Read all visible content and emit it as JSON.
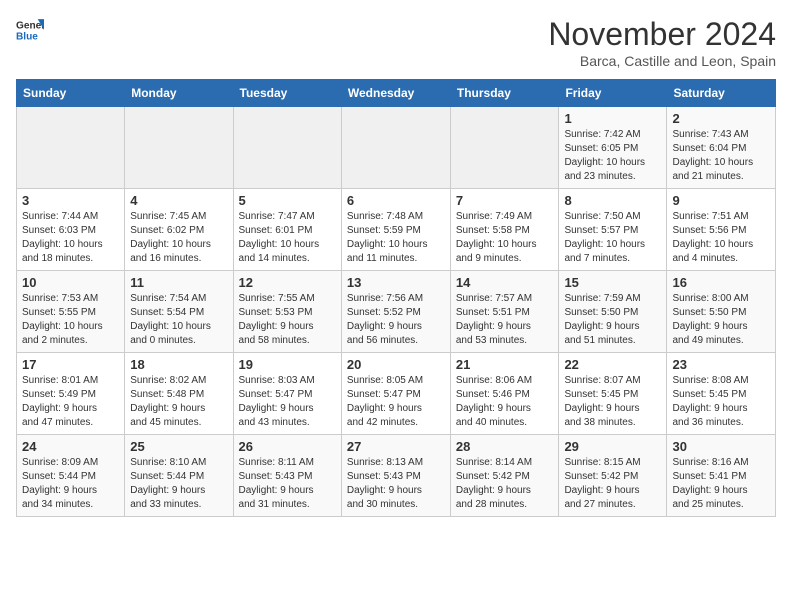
{
  "logo": {
    "line1": "General",
    "line2": "Blue"
  },
  "title": "November 2024",
  "subtitle": "Barca, Castille and Leon, Spain",
  "weekdays": [
    "Sunday",
    "Monday",
    "Tuesday",
    "Wednesday",
    "Thursday",
    "Friday",
    "Saturday"
  ],
  "weeks": [
    [
      {
        "day": "",
        "info": ""
      },
      {
        "day": "",
        "info": ""
      },
      {
        "day": "",
        "info": ""
      },
      {
        "day": "",
        "info": ""
      },
      {
        "day": "",
        "info": ""
      },
      {
        "day": "1",
        "info": "Sunrise: 7:42 AM\nSunset: 6:05 PM\nDaylight: 10 hours\nand 23 minutes."
      },
      {
        "day": "2",
        "info": "Sunrise: 7:43 AM\nSunset: 6:04 PM\nDaylight: 10 hours\nand 21 minutes."
      }
    ],
    [
      {
        "day": "3",
        "info": "Sunrise: 7:44 AM\nSunset: 6:03 PM\nDaylight: 10 hours\nand 18 minutes."
      },
      {
        "day": "4",
        "info": "Sunrise: 7:45 AM\nSunset: 6:02 PM\nDaylight: 10 hours\nand 16 minutes."
      },
      {
        "day": "5",
        "info": "Sunrise: 7:47 AM\nSunset: 6:01 PM\nDaylight: 10 hours\nand 14 minutes."
      },
      {
        "day": "6",
        "info": "Sunrise: 7:48 AM\nSunset: 5:59 PM\nDaylight: 10 hours\nand 11 minutes."
      },
      {
        "day": "7",
        "info": "Sunrise: 7:49 AM\nSunset: 5:58 PM\nDaylight: 10 hours\nand 9 minutes."
      },
      {
        "day": "8",
        "info": "Sunrise: 7:50 AM\nSunset: 5:57 PM\nDaylight: 10 hours\nand 7 minutes."
      },
      {
        "day": "9",
        "info": "Sunrise: 7:51 AM\nSunset: 5:56 PM\nDaylight: 10 hours\nand 4 minutes."
      }
    ],
    [
      {
        "day": "10",
        "info": "Sunrise: 7:53 AM\nSunset: 5:55 PM\nDaylight: 10 hours\nand 2 minutes."
      },
      {
        "day": "11",
        "info": "Sunrise: 7:54 AM\nSunset: 5:54 PM\nDaylight: 10 hours\nand 0 minutes."
      },
      {
        "day": "12",
        "info": "Sunrise: 7:55 AM\nSunset: 5:53 PM\nDaylight: 9 hours\nand 58 minutes."
      },
      {
        "day": "13",
        "info": "Sunrise: 7:56 AM\nSunset: 5:52 PM\nDaylight: 9 hours\nand 56 minutes."
      },
      {
        "day": "14",
        "info": "Sunrise: 7:57 AM\nSunset: 5:51 PM\nDaylight: 9 hours\nand 53 minutes."
      },
      {
        "day": "15",
        "info": "Sunrise: 7:59 AM\nSunset: 5:50 PM\nDaylight: 9 hours\nand 51 minutes."
      },
      {
        "day": "16",
        "info": "Sunrise: 8:00 AM\nSunset: 5:50 PM\nDaylight: 9 hours\nand 49 minutes."
      }
    ],
    [
      {
        "day": "17",
        "info": "Sunrise: 8:01 AM\nSunset: 5:49 PM\nDaylight: 9 hours\nand 47 minutes."
      },
      {
        "day": "18",
        "info": "Sunrise: 8:02 AM\nSunset: 5:48 PM\nDaylight: 9 hours\nand 45 minutes."
      },
      {
        "day": "19",
        "info": "Sunrise: 8:03 AM\nSunset: 5:47 PM\nDaylight: 9 hours\nand 43 minutes."
      },
      {
        "day": "20",
        "info": "Sunrise: 8:05 AM\nSunset: 5:47 PM\nDaylight: 9 hours\nand 42 minutes."
      },
      {
        "day": "21",
        "info": "Sunrise: 8:06 AM\nSunset: 5:46 PM\nDaylight: 9 hours\nand 40 minutes."
      },
      {
        "day": "22",
        "info": "Sunrise: 8:07 AM\nSunset: 5:45 PM\nDaylight: 9 hours\nand 38 minutes."
      },
      {
        "day": "23",
        "info": "Sunrise: 8:08 AM\nSunset: 5:45 PM\nDaylight: 9 hours\nand 36 minutes."
      }
    ],
    [
      {
        "day": "24",
        "info": "Sunrise: 8:09 AM\nSunset: 5:44 PM\nDaylight: 9 hours\nand 34 minutes."
      },
      {
        "day": "25",
        "info": "Sunrise: 8:10 AM\nSunset: 5:44 PM\nDaylight: 9 hours\nand 33 minutes."
      },
      {
        "day": "26",
        "info": "Sunrise: 8:11 AM\nSunset: 5:43 PM\nDaylight: 9 hours\nand 31 minutes."
      },
      {
        "day": "27",
        "info": "Sunrise: 8:13 AM\nSunset: 5:43 PM\nDaylight: 9 hours\nand 30 minutes."
      },
      {
        "day": "28",
        "info": "Sunrise: 8:14 AM\nSunset: 5:42 PM\nDaylight: 9 hours\nand 28 minutes."
      },
      {
        "day": "29",
        "info": "Sunrise: 8:15 AM\nSunset: 5:42 PM\nDaylight: 9 hours\nand 27 minutes."
      },
      {
        "day": "30",
        "info": "Sunrise: 8:16 AM\nSunset: 5:41 PM\nDaylight: 9 hours\nand 25 minutes."
      }
    ]
  ]
}
